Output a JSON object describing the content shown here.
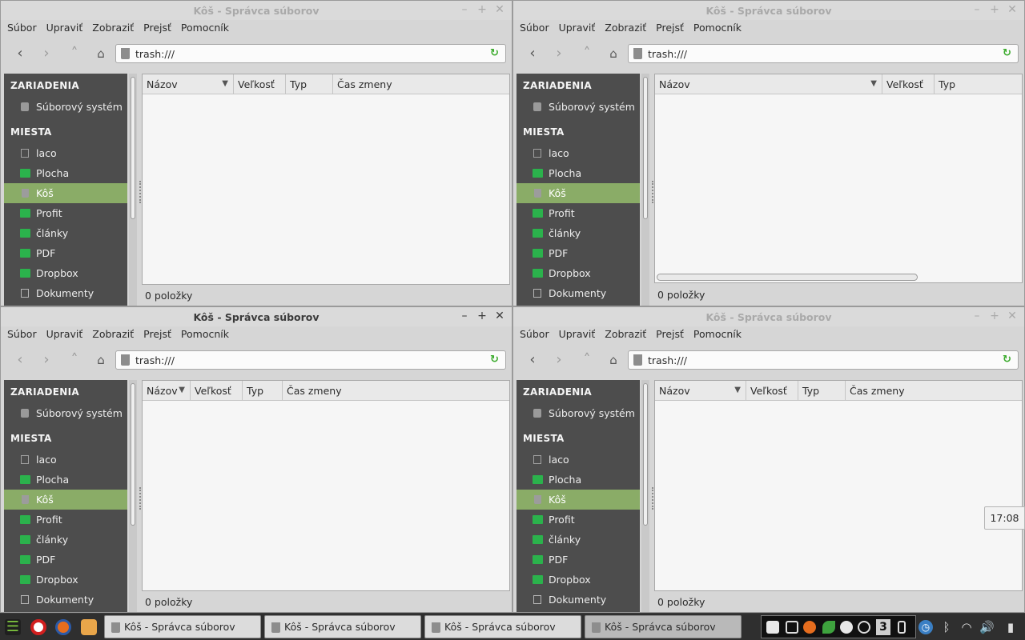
{
  "windows": [
    {
      "id": "tl",
      "active": false,
      "title": "Kôš - Správca súborov",
      "menu": [
        "Súbor",
        "Upraviť",
        "Zobraziť",
        "Prejsť",
        "Pomocník"
      ],
      "address": "trash:///",
      "columns": [
        "Názov",
        "Veľkosť",
        "Typ",
        "Čas zmeny"
      ],
      "status": "0 položky"
    },
    {
      "id": "tr",
      "active": false,
      "title": "Kôš - Správca súborov",
      "menu": [
        "Súbor",
        "Upraviť",
        "Zobraziť",
        "Prejsť",
        "Pomocník"
      ],
      "address": "trash:///",
      "columns": [
        "Názov",
        "Veľkosť",
        "Typ"
      ],
      "status": "0 položky"
    },
    {
      "id": "bl",
      "active": true,
      "title": "Kôš - Správca súborov",
      "menu": [
        "Súbor",
        "Upraviť",
        "Zobraziť",
        "Prejsť",
        "Pomocník"
      ],
      "address": "trash:///",
      "columns": [
        "Názov",
        "Veľkosť",
        "Typ",
        "Čas zmeny"
      ],
      "status": "0 položky"
    },
    {
      "id": "br",
      "active": false,
      "title": "Kôš - Správca súborov",
      "menu": [
        "Súbor",
        "Upraviť",
        "Zobraziť",
        "Prejsť",
        "Pomocník"
      ],
      "address": "trash:///",
      "columns": [
        "Názov",
        "Veľkosť",
        "Typ",
        "Čas zmeny"
      ],
      "status": "0 položky"
    }
  ],
  "sidebar": {
    "devices_heading": "ZARIADENIA",
    "places_heading": "MIESTA",
    "devices": [
      {
        "label": "Súborový systém",
        "icon": "drive-icon"
      }
    ],
    "places": [
      {
        "label": "laco",
        "icon": "home-icon",
        "selected": false
      },
      {
        "label": "Plocha",
        "icon": "folder-icon",
        "selected": false
      },
      {
        "label": "Kôš",
        "icon": "trash-icon",
        "selected": true
      },
      {
        "label": "Profit",
        "icon": "folder-icon",
        "selected": false
      },
      {
        "label": "články",
        "icon": "folder-icon",
        "selected": false
      },
      {
        "label": "PDF",
        "icon": "folder-icon",
        "selected": false
      },
      {
        "label": "Dropbox",
        "icon": "folder-icon",
        "selected": false
      },
      {
        "label": "Dokumenty",
        "icon": "document-icon",
        "selected": false
      }
    ]
  },
  "clock": "17:08",
  "taskbar": {
    "tasks": [
      {
        "label": "Kôš - Správca súborov",
        "active": false
      },
      {
        "label": "Kôš - Správca súborov",
        "active": false
      },
      {
        "label": "Kôš - Správca súborov",
        "active": false
      },
      {
        "label": "Kôš - Správca súborov",
        "active": true
      }
    ],
    "workspace": "3"
  },
  "colors": {
    "sidebar_bg": "#4d4d4d",
    "selection": "#8aac67",
    "folder": "#2bb24c",
    "window_bg": "#d6d6d6"
  }
}
